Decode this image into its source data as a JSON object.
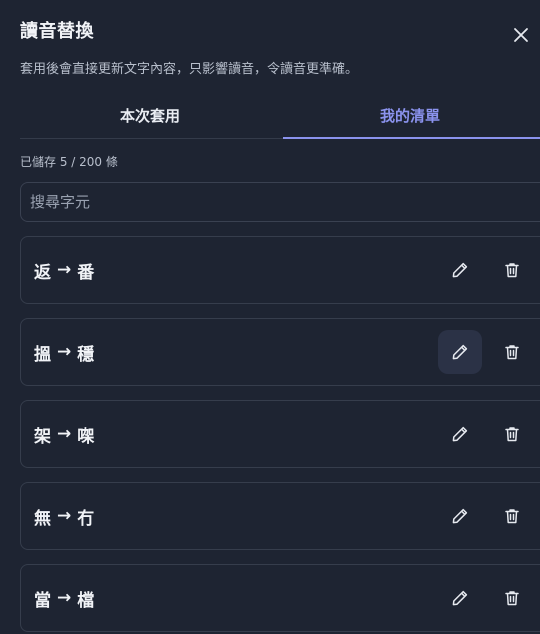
{
  "dialog": {
    "title": "讀音替換",
    "subtitle": "套用後會直接更新文字內容，只影響讀音，令讀音更準確。",
    "close_icon": "close-icon"
  },
  "tabs": [
    {
      "label": "本次套用",
      "active": false
    },
    {
      "label": "我的清單",
      "active": true
    }
  ],
  "saved_count": "已儲存 5 / 200 條",
  "search": {
    "placeholder": "搜尋字元",
    "value": ""
  },
  "rules": [
    {
      "from": "返",
      "arrow": "→",
      "to": "番",
      "edit_hover": false
    },
    {
      "from": "搵",
      "arrow": "→",
      "to": "穩",
      "edit_hover": true
    },
    {
      "from": "架",
      "arrow": "→",
      "to": "㗎",
      "edit_hover": false
    },
    {
      "from": "無",
      "arrow": "→",
      "to": "冇",
      "edit_hover": false
    },
    {
      "from": "當",
      "arrow": "→",
      "to": "檔",
      "edit_hover": false
    }
  ],
  "icons": {
    "edit": "pencil-icon",
    "delete": "trash-icon"
  },
  "colors": {
    "background": "#1e2432",
    "accent": "#8b93ee",
    "border": "#363d4c",
    "text": "#f1f3f7",
    "muted_text": "#b8bfcc"
  }
}
